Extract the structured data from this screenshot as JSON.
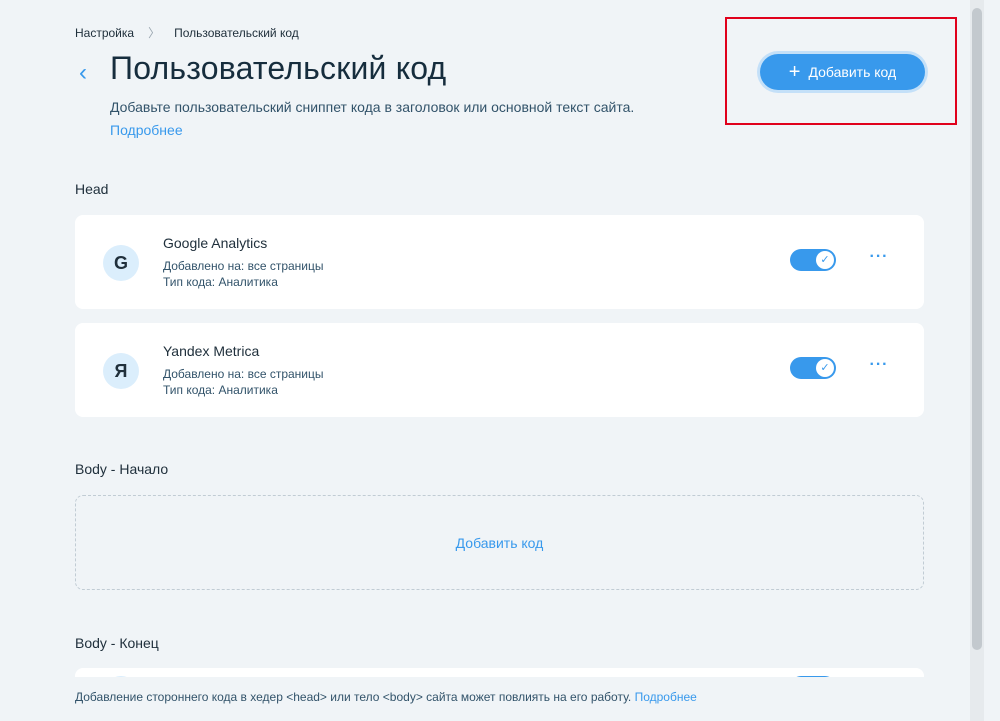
{
  "breadcrumb": {
    "parent": "Настройка",
    "separator": "〉",
    "current": "Пользовательский код"
  },
  "header": {
    "title": "Пользовательский код",
    "subtitle": "Добавьте пользовательский сниппет кода в заголовок или основной текст сайта.",
    "learn_more": "Подробнее",
    "add_button": "Добавить код",
    "back_glyph": "‹",
    "plus_glyph": "+"
  },
  "sections": {
    "head": {
      "label": "Head",
      "items": [
        {
          "icon_letter": "G",
          "name": "Google Analytics",
          "pages": "Добавлено на: все страницы",
          "type": "Тип кода: Аналитика",
          "enabled": true
        },
        {
          "icon_letter": "Я",
          "name": "Yandex Metrica",
          "pages": "Добавлено на: все страницы",
          "type": "Тип кода: Аналитика",
          "enabled": true
        }
      ]
    },
    "body_start": {
      "label": "Body - Начало",
      "add_link": "Добавить код"
    },
    "body_end": {
      "label": "Body - Конец"
    }
  },
  "footer": {
    "text": "Добавление стороннего кода в хедер <head> или тело <body> сайта может повлиять на его работу.",
    "link": "Подробнее"
  },
  "icons": {
    "toggle_check": "check-icon",
    "more": "more-icon",
    "back": "chevron-left-icon",
    "plus": "plus-icon"
  },
  "colors": {
    "accent": "#3899ec",
    "highlight": "#e0001b",
    "background": "#f0f4f7"
  }
}
